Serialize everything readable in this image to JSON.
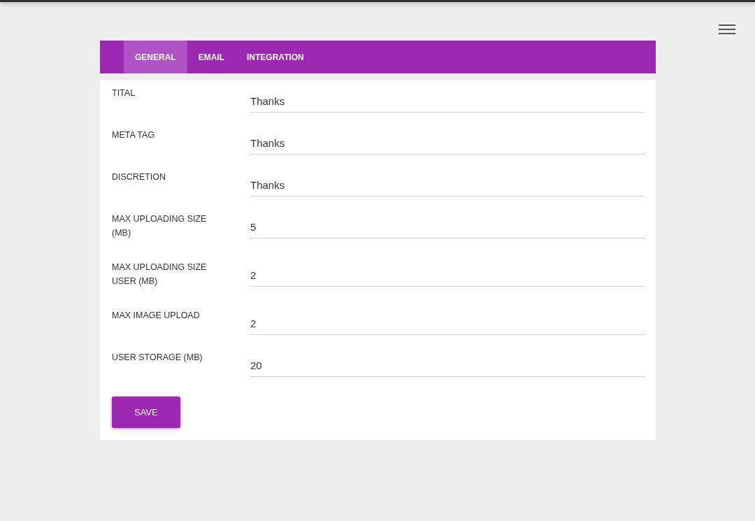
{
  "tabs": [
    {
      "label": "GENERAL",
      "selected": true
    },
    {
      "label": "EMAIL",
      "selected": false
    },
    {
      "label": "INTEGRATION",
      "selected": false
    }
  ],
  "fields": [
    {
      "label": "TITAL",
      "value": "Thanks"
    },
    {
      "label": "META TAG",
      "value": "Thanks"
    },
    {
      "label": "DISCRETION",
      "value": "Thanks"
    },
    {
      "label": "MAX UPLOADING SIZE (MB)",
      "value": "5"
    },
    {
      "label": "MAX UPLOADING SIZE USER (MB)",
      "value": "2"
    },
    {
      "label": "MAX IMAGE UPLOAD",
      "value": "2"
    },
    {
      "label": "USER STORAGE (MB)",
      "value": "20"
    }
  ],
  "save_button": "SAVE"
}
